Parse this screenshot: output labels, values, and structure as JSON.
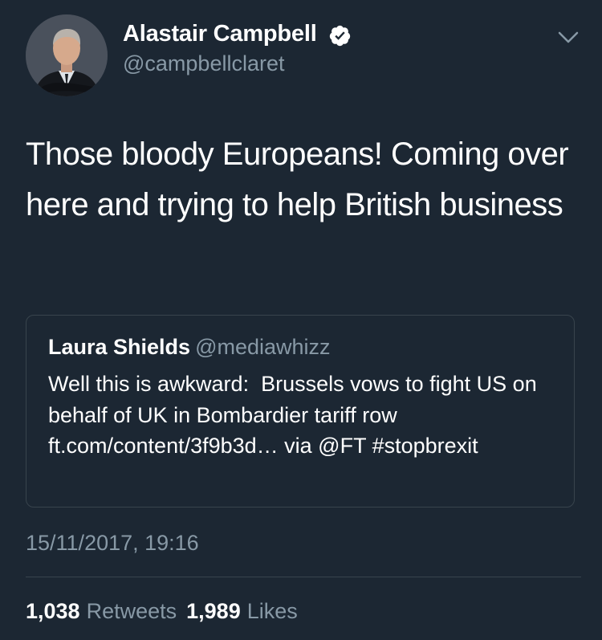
{
  "author": {
    "name": "Alastair Campbell",
    "handle": "@campbellclaret",
    "verified": true,
    "avatar_icon": "profile-photo"
  },
  "tweet": {
    "text": "Those bloody Europeans! Coming over here and trying to help British business"
  },
  "quoted_tweet": {
    "name": "Laura Shields",
    "handle": "@mediawhizz",
    "text": "Well this is awkward:  Brussels vows to fight US on behalf of UK in Bombardier tariff row ft.com/content/3f9b3d… via @FT #stopbrexit"
  },
  "timestamp": "15/11/2017, 19:16",
  "stats": {
    "retweets_count": "1,038",
    "retweets_label": "Retweets",
    "likes_count": "1,989",
    "likes_label": "Likes"
  },
  "colors": {
    "background": "#1c2733",
    "secondary_text": "#8899a6",
    "border": "#38444d",
    "verified_badge": "#ffffff"
  },
  "icons": {
    "verified": "verified-badge-icon",
    "menu": "chevron-down-icon"
  }
}
